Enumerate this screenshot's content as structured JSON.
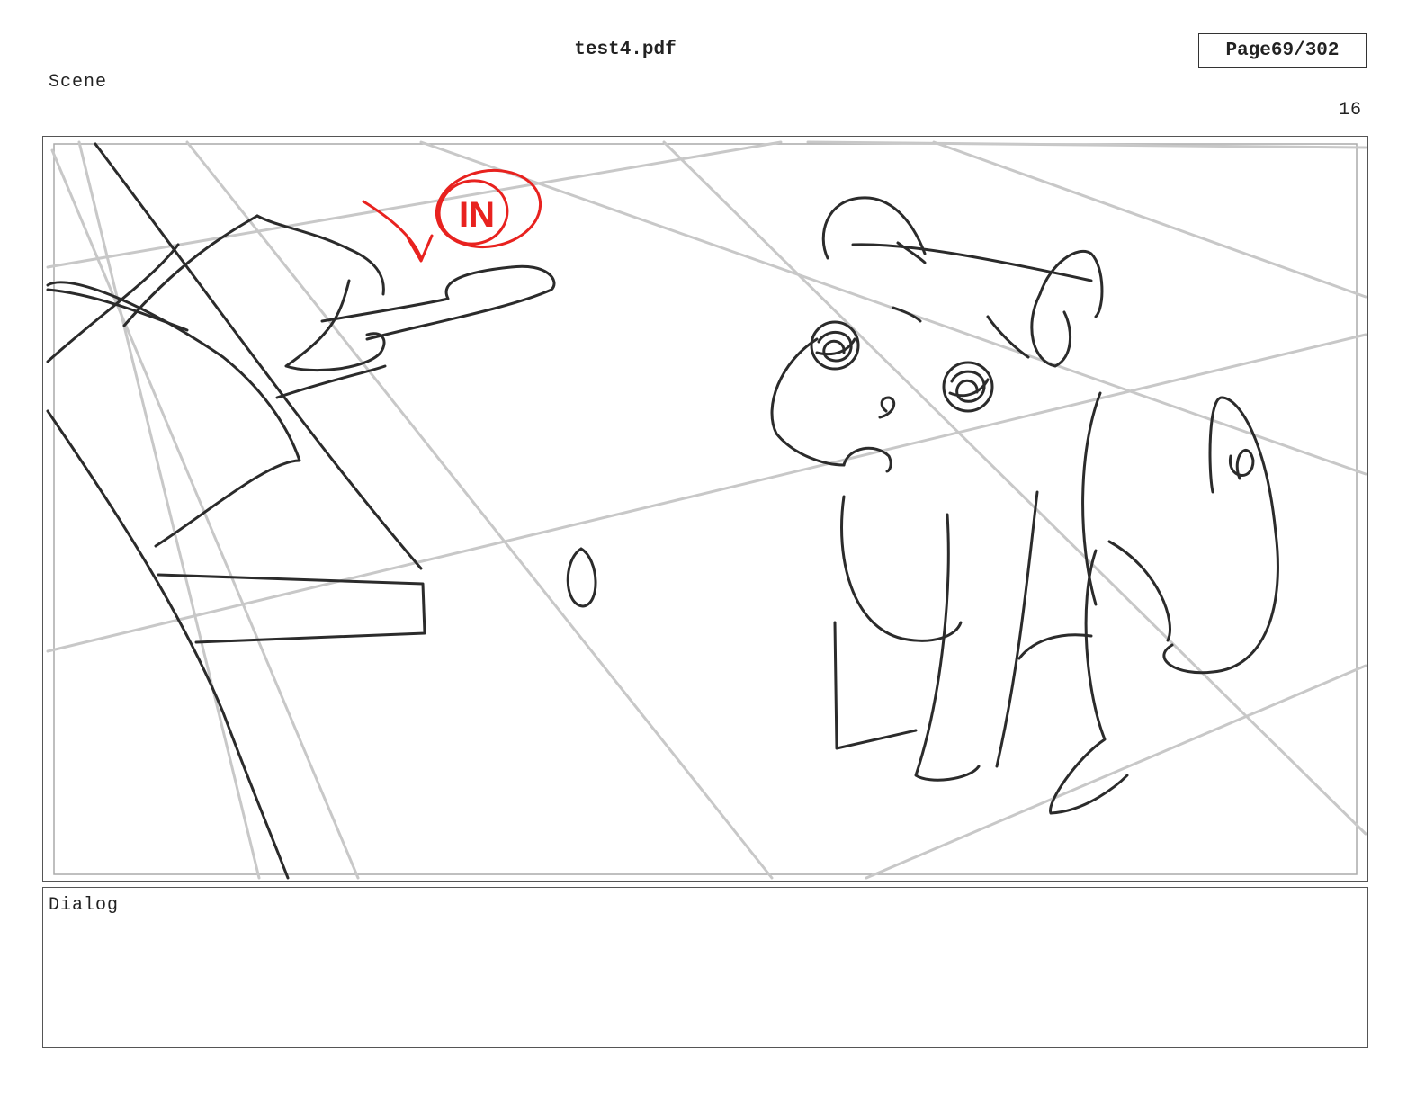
{
  "header": {
    "title": "test4.pdf",
    "page_label": "Page",
    "page_value": "69/302",
    "scene_label": "Scene",
    "panel_number": "16"
  },
  "panel": {
    "annotation_text": "IN",
    "annotation_color": "#e8221f",
    "sketch_color": "#2b2b2b",
    "guide_color": "#c8c8c8"
  },
  "dialog": {
    "label": "Dialog",
    "text": ""
  }
}
